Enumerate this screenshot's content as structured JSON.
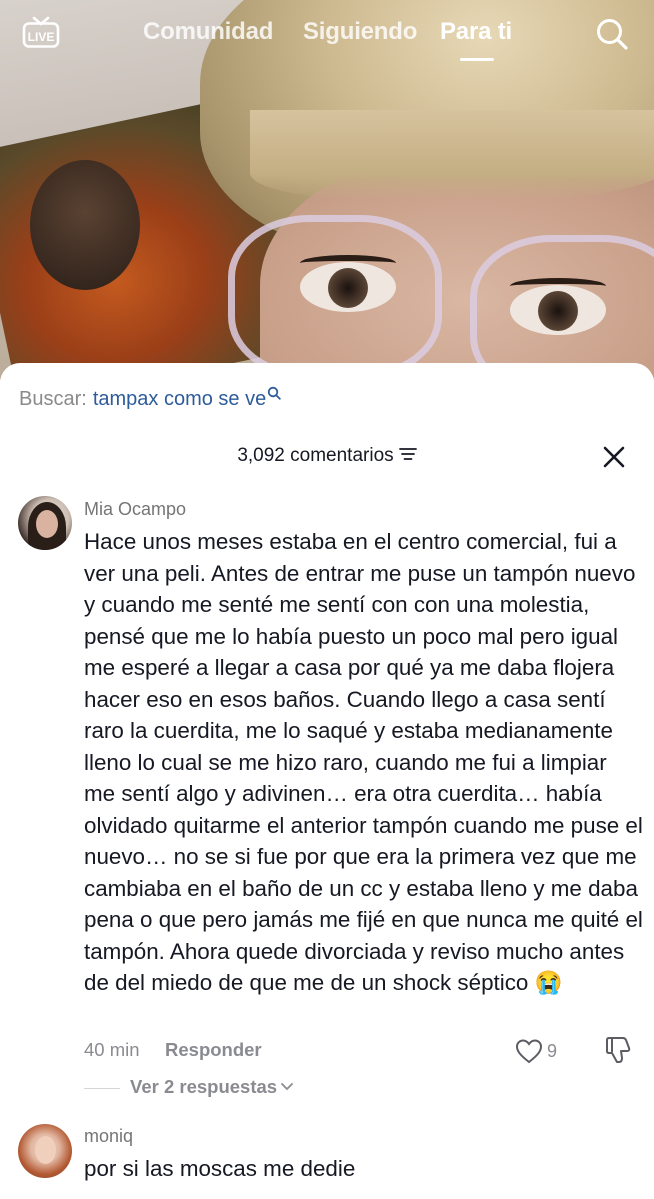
{
  "topnav": {
    "live_label": "LIVE",
    "tabs": [
      {
        "label": "Comunidad",
        "active": false
      },
      {
        "label": "Siguiendo",
        "active": false
      },
      {
        "label": "Para ti",
        "active": true
      }
    ],
    "search_icon": "search-icon"
  },
  "sheet": {
    "search_prefix": "Buscar:",
    "search_query": "tampax como se ve",
    "comment_count": "3,092 comentarios",
    "filter_icon": "filter-icon",
    "close_icon": "close-icon"
  },
  "comments": [
    {
      "username": "Mia Ocampo",
      "text": "Hace unos meses estaba en el centro comercial, fui a ver una peli. Antes de entrar me puse un tampón nuevo y cuando me senté me sentí con con una molestia, pensé que me lo había puesto un poco mal pero igual me esperé a llegar a casa por qué ya me daba flojera hacer eso en esos baños. Cuando llego a casa sentí raro la cuerdita, me lo saqué y estaba medianamente lleno lo cual se me hizo raro, cuando me fui a limpiar me sentí algo y adivinen… era otra cuerdita… había olvidado quitarme el anterior tampón cuando me puse el nuevo… no se si fue por que era la primera vez que me cambiaba en el baño de un cc y estaba lleno y me daba pena o que pero jamás me fijé en que nunca me quité el tampón. Ahora quede divorciada y reviso mucho antes de del miedo de que me de un shock séptico 😭",
      "time": "40 min",
      "reply_label": "Responder",
      "likes": "9",
      "view_replies": "Ver 2 respuestas"
    },
    {
      "username": "moniq",
      "text": "por si las moscas me dedie"
    }
  ],
  "colors": {
    "link_blue": "#2e5c9a",
    "text_dark": "#161823",
    "text_gray": "#8a8b91"
  }
}
